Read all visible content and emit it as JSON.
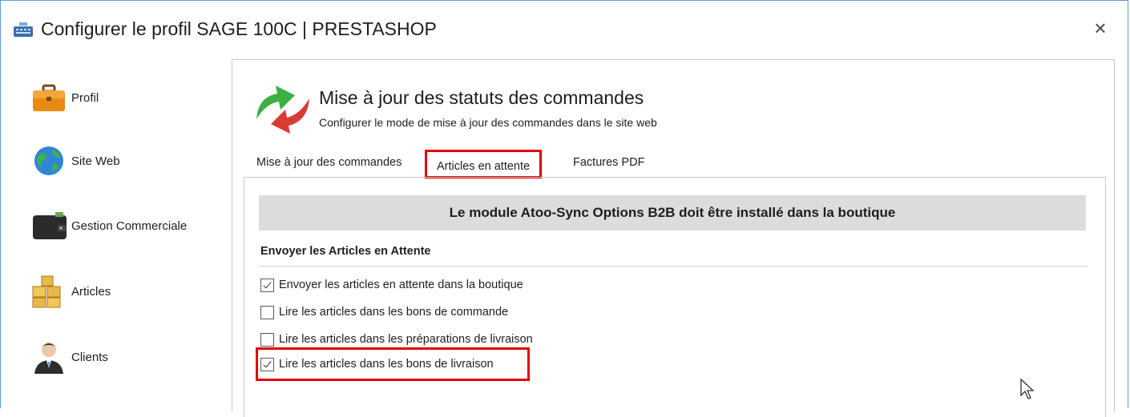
{
  "window": {
    "title": "Configurer le profil SAGE 100C |  PRESTASHOP",
    "close_label": "×"
  },
  "sidebar": {
    "items": [
      {
        "label": "Profil",
        "icon": "briefcase-icon"
      },
      {
        "label": "Site Web",
        "icon": "globe-icon"
      },
      {
        "label": "Gestion Commerciale",
        "icon": "wallet-icon"
      },
      {
        "label": "Articles",
        "icon": "boxes-icon"
      },
      {
        "label": "Clients",
        "icon": "person-icon"
      }
    ]
  },
  "header": {
    "title": "Mise à jour des statuts des commandes",
    "subtitle": "Configurer le mode de mise à jour des commandes dans le site web"
  },
  "tabs": [
    {
      "label": "Mise à jour des commandes",
      "active": false
    },
    {
      "label": "Articles en attente",
      "active": true
    },
    {
      "label": "Factures PDF",
      "active": false
    }
  ],
  "panel": {
    "banner": "Le module Atoo-Sync Options B2B doit être installé dans la boutique",
    "section_label": "Envoyer les Articles en Attente",
    "checkboxes": [
      {
        "label": "Envoyer les articles en attente dans la boutique",
        "checked": true
      },
      {
        "label": "Lire les articles dans les bons de commande",
        "checked": false
      },
      {
        "label": "Lire les articles dans les préparations de livraison",
        "checked": false
      },
      {
        "label": "Lire les articles dans les bons de livraison",
        "checked": true
      }
    ]
  },
  "colors": {
    "highlight": "#e00000",
    "banner_bg": "#dcdcdc",
    "window_border": "#5b9bd5"
  }
}
